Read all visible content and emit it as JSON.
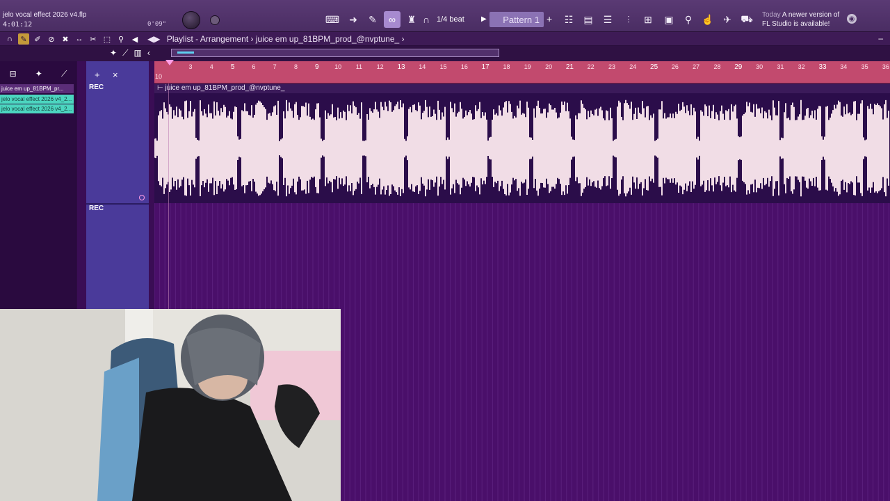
{
  "toolbar": {
    "project_name": "jelo vocal effect 2026 v4.flp",
    "project_time": "4:01:12",
    "song_position": "0'09\"",
    "snap": "1/4 beat",
    "snap_arrow": "▶",
    "pattern": "Pattern 1",
    "pattern_add": "+",
    "news_today": "Today",
    "news_message_1": "A newer version of",
    "news_message_2": "FL Studio is available!"
  },
  "playlist": {
    "play_icon": "◀▶",
    "title": "Playlist - Arrangement",
    "separator": "›",
    "clip_name": "juice em up_81BPM_prod_@nvptune_",
    "crumb_end": "›",
    "minimize": "–"
  },
  "picker": {
    "items": [
      {
        "label": "juice em up_81BPM_pr...",
        "kind": "audio"
      },
      {
        "label": "jelo vocal effect 2026 v4_2...",
        "kind": "clip"
      },
      {
        "label": "jelo vocal effect 2026 v4_2...",
        "kind": "clip"
      }
    ]
  },
  "tracks": {
    "add": "+",
    "delete": "×",
    "rec_1": "REC",
    "rec_2": "REC"
  },
  "clip": {
    "label": "juice em up_81BPM_prod_@nvptune_"
  },
  "ruler": {
    "start_label": "10",
    "bars": [
      "3",
      "4",
      "5",
      "6",
      "7",
      "8",
      "9",
      "10",
      "11",
      "12",
      "13",
      "14",
      "15",
      "16",
      "17",
      "18",
      "19",
      "20",
      "21",
      "22",
      "23",
      "24",
      "25",
      "26",
      "27",
      "28",
      "29",
      "30",
      "31",
      "32",
      "33",
      "34",
      "35",
      "36"
    ]
  },
  "colors": {
    "accent": "#a78ad0",
    "ruler": "#c24a6e",
    "clip_teal": "#4cd6c0",
    "track_header": "#4a3a9a",
    "waveform": "#f1dde6"
  }
}
